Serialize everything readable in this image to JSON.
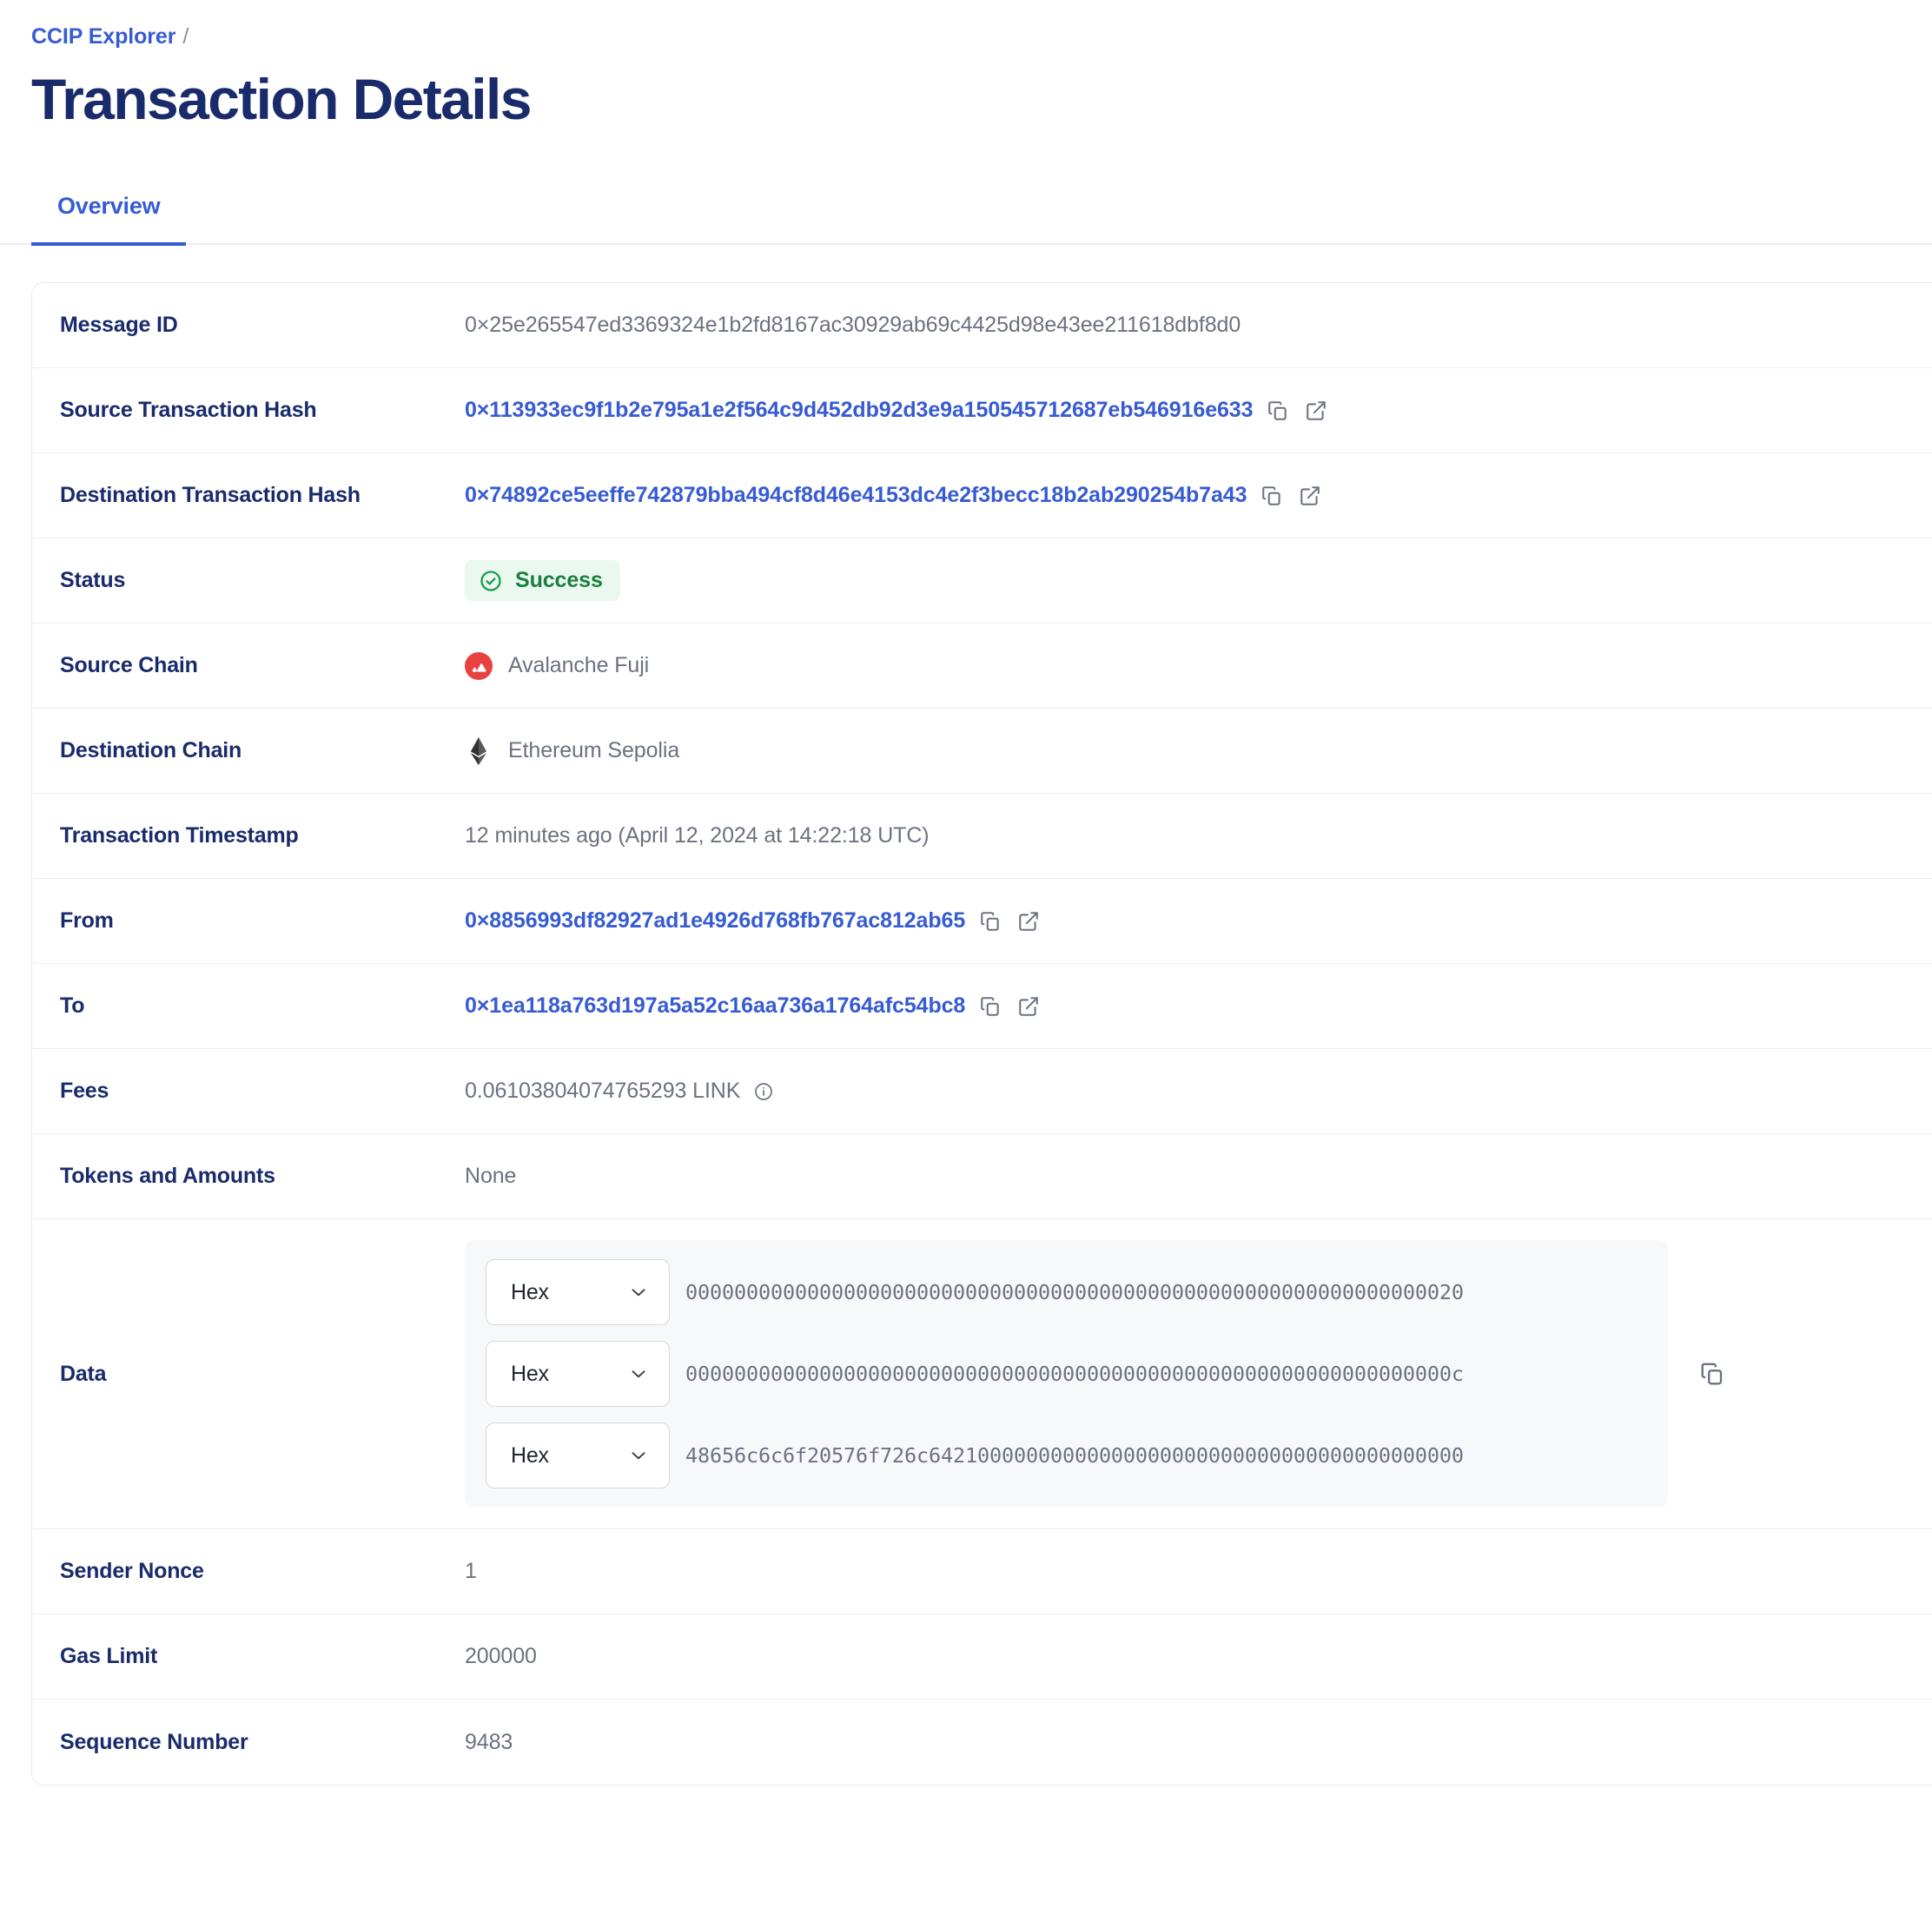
{
  "breadcrumb": {
    "root": "CCIP Explorer",
    "separator": "/"
  },
  "page_title": "Transaction Details",
  "tabs": [
    {
      "label": "Overview",
      "active": true
    }
  ],
  "colors": {
    "brand_blue": "#375bd2",
    "title_navy": "#1a2b6b",
    "value_gray": "#6b7280",
    "success_green": "#1a7f3c",
    "success_bg": "#eaf8ef",
    "avalanche_red": "#e84142",
    "ethereum_dark": "#3c3c3d",
    "panel_bg": "#f7f8fa"
  },
  "details": {
    "message_id": {
      "label": "Message ID",
      "value": "0×25e265547ed3369324e1b2fd8167ac30929ab69c4425d98e43ee211618dbf8d0"
    },
    "source_tx_hash": {
      "label": "Source Transaction Hash",
      "value": "0×113933ec9f1b2e795a1e2f564c9d452db92d3e9a150545712687eb546916e633"
    },
    "destination_tx_hash": {
      "label": "Destination Transaction Hash",
      "value": "0×74892ce5eeffe742879bba494cf8d46e4153dc4e2f3becc18b2ab290254b7a43"
    },
    "status": {
      "label": "Status",
      "value": "Success"
    },
    "source_chain": {
      "label": "Source Chain",
      "value": "Avalanche Fuji",
      "icon": "avalanche-icon"
    },
    "destination_chain": {
      "label": "Destination Chain",
      "value": "Ethereum Sepolia",
      "icon": "ethereum-icon"
    },
    "timestamp": {
      "label": "Transaction Timestamp",
      "value": "12 minutes ago (April 12, 2024 at 14:22:18 UTC)"
    },
    "from": {
      "label": "From",
      "value": "0×8856993df82927ad1e4926d768fb767ac812ab65"
    },
    "to": {
      "label": "To",
      "value": "0×1ea118a763d197a5a52c16aa736a1764afc54bc8"
    },
    "fees": {
      "label": "Fees",
      "value": "0.06103804074765293 LINK"
    },
    "tokens_and_amounts": {
      "label": "Tokens and Amounts",
      "value": "None"
    },
    "data": {
      "label": "Data",
      "encoding_selected": "Hex",
      "lines": [
        "0000000000000000000000000000000000000000000000000000000000000020",
        "000000000000000000000000000000000000000000000000000000000000000c",
        "48656c6c6f20576f726c64210000000000000000000000000000000000000000"
      ]
    },
    "sender_nonce": {
      "label": "Sender Nonce",
      "value": "1"
    },
    "gas_limit": {
      "label": "Gas Limit",
      "value": "200000"
    },
    "sequence_number": {
      "label": "Sequence Number",
      "value": "9483"
    }
  },
  "icons": {
    "copy": "copy-icon",
    "external_link": "external-link-icon",
    "info": "info-icon",
    "chevron_down": "chevron-down-icon",
    "check_circle": "check-circle-icon"
  }
}
